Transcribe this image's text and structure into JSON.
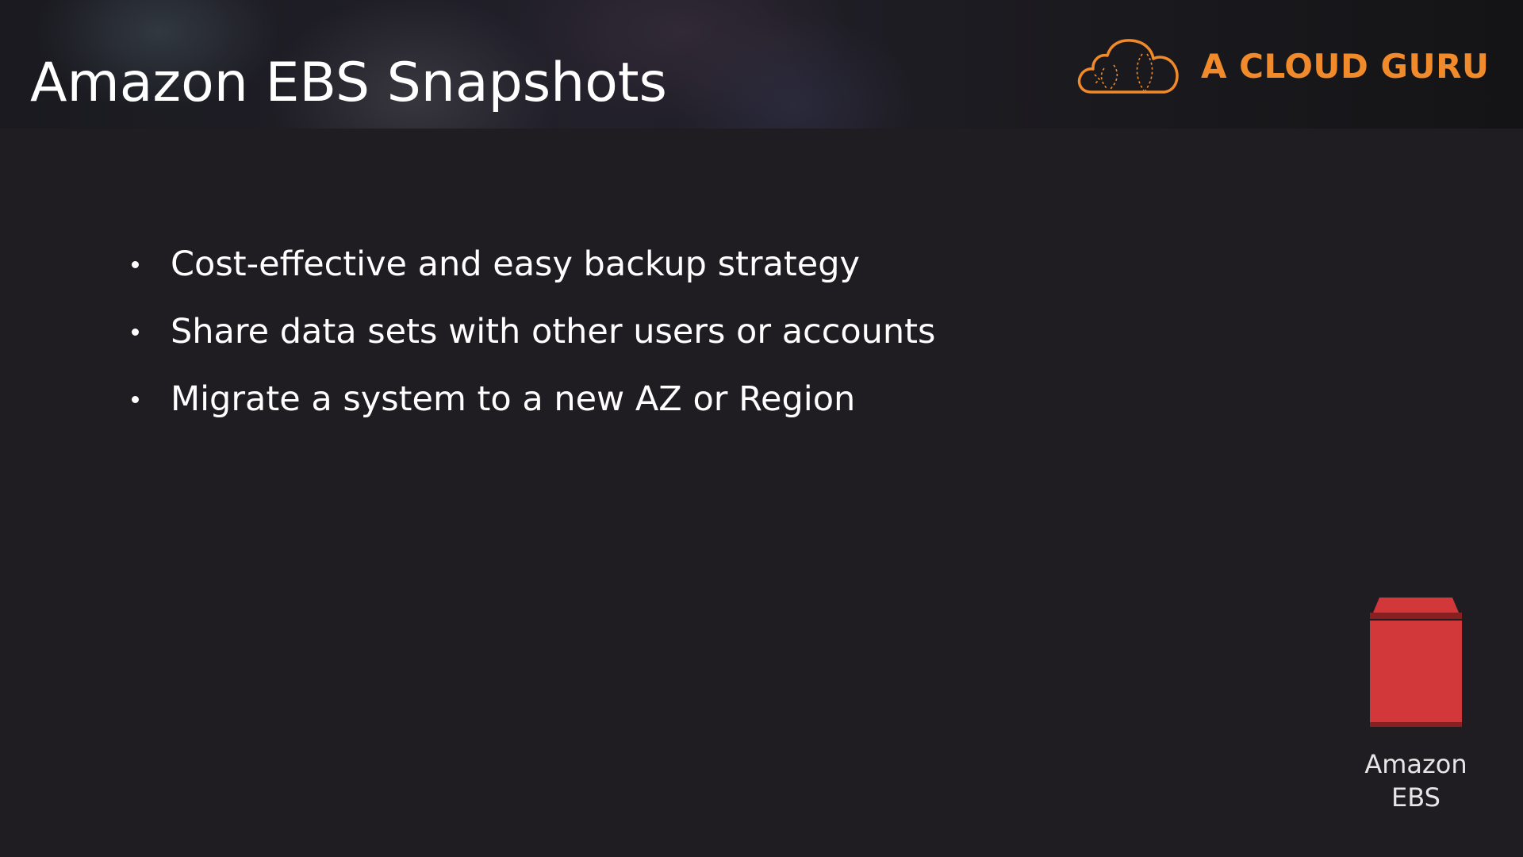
{
  "slide": {
    "title": "Amazon EBS Snapshots",
    "brand": {
      "name": "A CLOUD GURU",
      "color": "#f08a2a",
      "icon": "cloud-logo-icon"
    },
    "bullets": [
      "Cost-effective and easy backup strategy",
      "Share data sets with other users or accounts",
      "Migrate a system to a new AZ or Region"
    ],
    "service": {
      "icon": "amazon-ebs-icon",
      "color": "#d2373a",
      "label_line1": "Amazon",
      "label_line2": "EBS"
    }
  }
}
